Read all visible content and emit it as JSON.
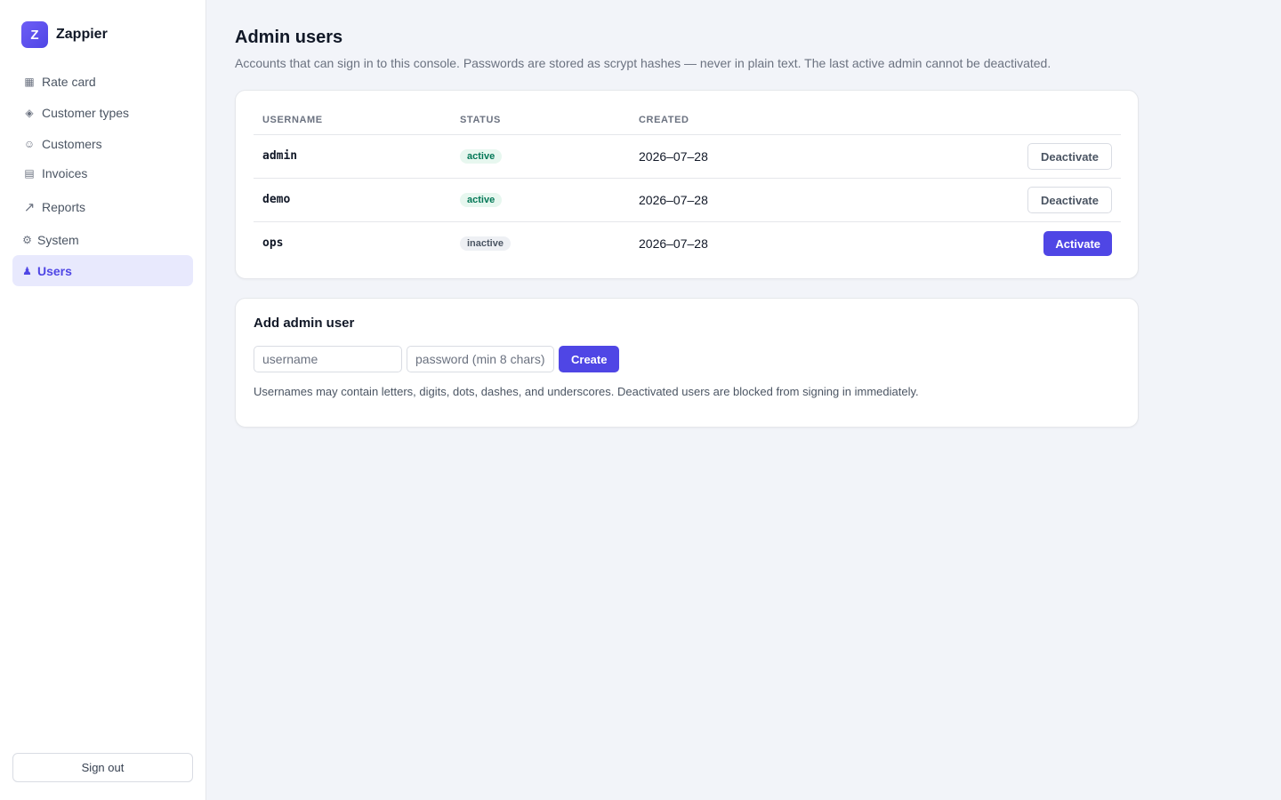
{
  "brand": {
    "logo_letter": "Z",
    "name": "Zappier"
  },
  "sidebar": {
    "items": [
      {
        "label": "Rate card",
        "icon": "grid-icon"
      },
      {
        "label": "Customer types",
        "icon": "diamond-icon"
      },
      {
        "label": "Customers",
        "icon": "smiley-icon"
      },
      {
        "label": "Invoices",
        "icon": "list-icon"
      },
      {
        "label": "Reports",
        "icon": "trend-arrow-icon"
      },
      {
        "label": "System",
        "icon": "gear-icon"
      },
      {
        "label": "Users",
        "icon": "user-icon",
        "active": true
      }
    ],
    "signout_label": "Sign out"
  },
  "page": {
    "title": "Admin users",
    "description": "Accounts that can sign in to this console. Passwords are stored as scrypt hashes — never in plain text. The last active admin cannot be deactivated."
  },
  "users_table": {
    "columns": [
      "Username",
      "Status",
      "Created"
    ],
    "rows": [
      {
        "username": "admin",
        "status": "active",
        "created": "2026–07–28",
        "action": "Deactivate"
      },
      {
        "username": "demo",
        "status": "active",
        "created": "2026–07–28",
        "action": "Deactivate"
      },
      {
        "username": "ops",
        "status": "inactive",
        "created": "2026–07–28",
        "action": "Activate"
      }
    ]
  },
  "add_user": {
    "title": "Add admin user",
    "username_placeholder": "username",
    "password_placeholder": "password (min 8 chars)",
    "create_label": "Create",
    "help_text": "Usernames may contain letters, digits, dots, dashes, and underscores. Deactivated users are blocked from signing in immediately."
  },
  "colors": {
    "accent": "#4f46e5",
    "active_nav_bg": "#e8e9fd",
    "badge_active_bg": "#e7f7ef",
    "badge_active_text": "#047857",
    "badge_inactive_bg": "#eef0f4",
    "page_bg": "#f2f4f9"
  }
}
